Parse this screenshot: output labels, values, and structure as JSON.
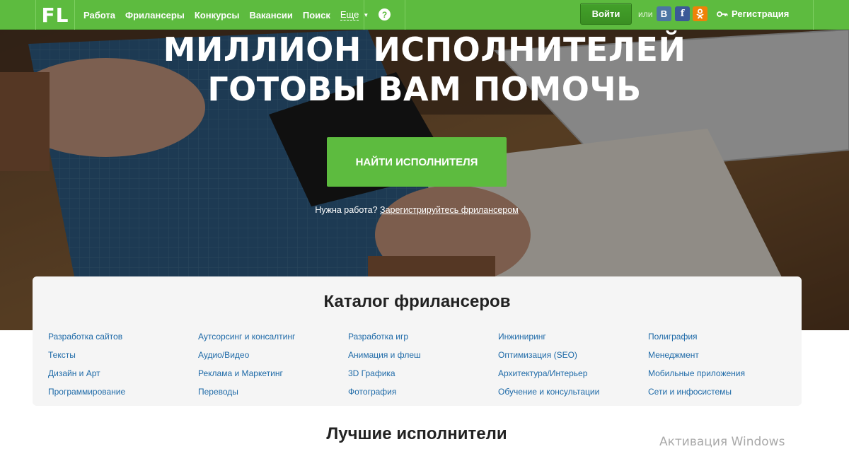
{
  "header": {
    "logo": "FL",
    "nav": [
      "Работа",
      "Фриланcеры",
      "Конкурсы",
      "Вакансии",
      "Поиск"
    ],
    "more": "Еще",
    "help": "?",
    "login": "Войти",
    "or": "или",
    "social": [
      "В",
      "f",
      "ок"
    ],
    "register": "Регистрация"
  },
  "hero": {
    "title_line1": "МИЛЛИОН ИСПОЛНИТЕЛЕЙ",
    "title_line2": "ГОТОВЫ ВАМ ПОМОЧЬ",
    "cta": "НАЙТИ ИСПОЛНИТЕЛЯ",
    "need_work": "Нужна работа?",
    "register_link": "Зарегистрируйтесь фрилансером"
  },
  "catalog": {
    "title": "Каталог фрилансеров",
    "columns": [
      [
        "Разработка сайтов",
        "Тексты",
        "Дизайн и Арт",
        "Программирование"
      ],
      [
        "Аутсорсинг и консалтинг",
        "Аудио/Видео",
        "Реклама и Маркетинг",
        "Переводы"
      ],
      [
        "Разработка игр",
        "Анимация и флеш",
        "3D Графика",
        "Фотография"
      ],
      [
        "Инжиниринг",
        "Оптимизация (SEO)",
        "Архитектура/Интерьер",
        "Обучение и консультации"
      ],
      [
        "Полиграфия",
        "Менеджмент",
        "Мобильные приложения",
        "Сети и инфосистемы"
      ]
    ]
  },
  "best_title": "Лучшие исполнители",
  "watermark": "Активация Windows",
  "colors": {
    "brand_green": "#5dbb3f",
    "link_blue": "#1e6aa8"
  }
}
